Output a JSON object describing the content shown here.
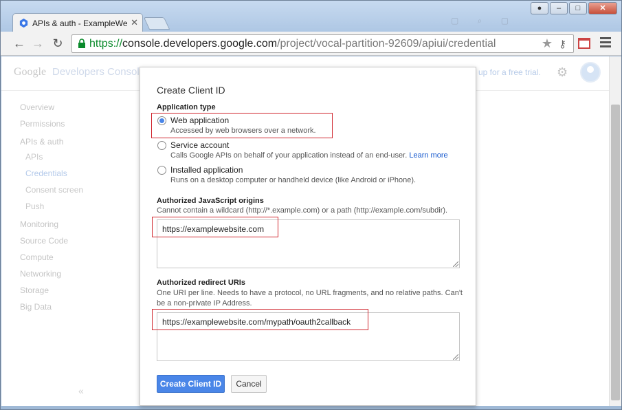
{
  "browser": {
    "tab_title": "APIs & auth - ExampleWe",
    "url_scheme": "https://",
    "url_host": "console.developers.google.com",
    "url_path": "/project/vocal-partition-92609/apiui/credential"
  },
  "header": {
    "logo": "Google",
    "title": "Developers Console",
    "trial_text": "up for a free trial."
  },
  "sidebar": {
    "items": [
      {
        "label": "Overview"
      },
      {
        "label": "Permissions"
      },
      {
        "label": "APIs & auth"
      },
      {
        "label": "APIs"
      },
      {
        "label": "Credentials"
      },
      {
        "label": "Consent screen"
      },
      {
        "label": "Push"
      },
      {
        "label": "Monitoring"
      },
      {
        "label": "Source Code"
      },
      {
        "label": "Compute"
      },
      {
        "label": "Networking"
      },
      {
        "label": "Storage"
      },
      {
        "label": "Big Data"
      }
    ],
    "collapse_label": "«"
  },
  "dialog": {
    "title": "Create Client ID",
    "app_type_label": "Application type",
    "options": [
      {
        "label": "Web application",
        "desc": "Accessed by web browsers over a network.",
        "selected": true
      },
      {
        "label": "Service account",
        "desc": "Calls Google APIs on behalf of your application instead of an end-user.",
        "link": "Learn more",
        "selected": false
      },
      {
        "label": "Installed application",
        "desc": "Runs on a desktop computer or handheld device (like Android or iPhone).",
        "selected": false
      }
    ],
    "js_origins": {
      "label": "Authorized JavaScript origins",
      "hint": "Cannot contain a wildcard (http://*.example.com) or a path (http://example.com/subdir).",
      "value": "https://examplewebsite.com"
    },
    "redirect_uris": {
      "label": "Authorized redirect URIs",
      "hint_line1": "One URI per line. Needs to have a protocol, no URL fragments, and no relative paths. Can't",
      "hint_line2": "be a non-private IP Address.",
      "value": "https://examplewebsite.com/mypath/oauth2callback"
    },
    "create_button": "Create Client ID",
    "cancel_button": "Cancel"
  },
  "colors": {
    "primary_button": "#4a86e8",
    "highlight_border": "#d0262e",
    "url_scheme": "#0a8a2b"
  }
}
